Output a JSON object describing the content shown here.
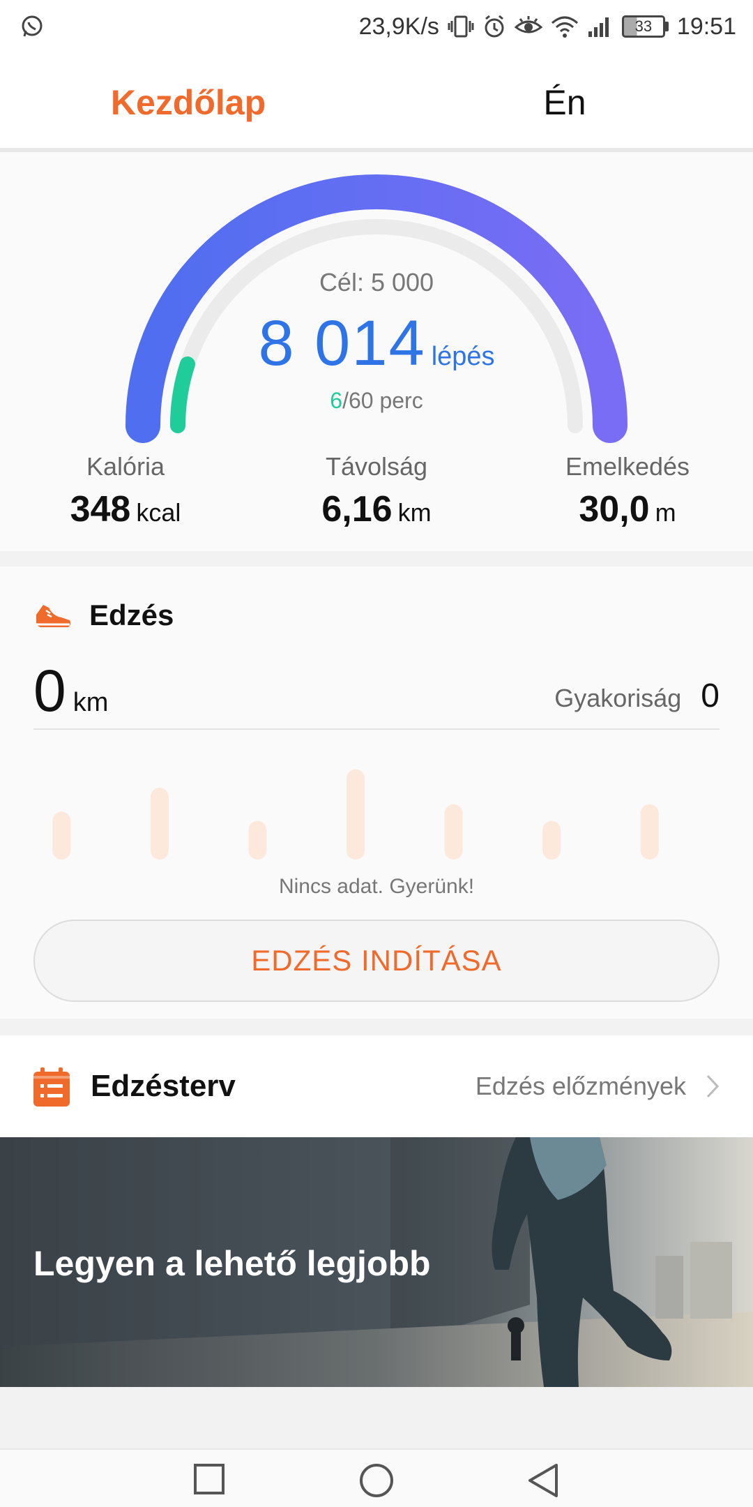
{
  "status_bar": {
    "left_icon": "whatsapp-icon",
    "network_speed": "23,9K/s",
    "icons": [
      "vibrate-icon",
      "alarm-icon",
      "eye-icon",
      "wifi-icon",
      "signal-icon"
    ],
    "battery_level": "33",
    "time": "19:51"
  },
  "tabs": [
    {
      "label": "Kezdőlap",
      "active": true
    },
    {
      "label": "Én",
      "active": false
    }
  ],
  "steps": {
    "goal_text": "Cél: 5 000",
    "count": "8 014",
    "unit": "lépés",
    "active_minutes": "6",
    "active_minutes_total": "/60 perc",
    "goal_progress": 1.0,
    "minutes_progress": 0.1
  },
  "metrics": [
    {
      "label": "Kalória",
      "value": "348",
      "unit": "kcal"
    },
    {
      "label": "Távolság",
      "value": "6,16",
      "unit": "km"
    },
    {
      "label": "Emelkedés",
      "value": "30,0",
      "unit": "m"
    }
  ],
  "workout": {
    "title": "Edzés",
    "icon": "running-shoe-icon",
    "distance": "0",
    "distance_unit": "km",
    "frequency_label": "Gyakoriság",
    "frequency_value": "0",
    "placeholder_bars": [
      0.52,
      0.78,
      0.42,
      0.98,
      0.6,
      0.42,
      0.6
    ],
    "no_data_text": "Nincs adat. Gyerünk!",
    "start_button": "EDZÉS INDÍTÁSA"
  },
  "plan": {
    "icon": "plan-list-icon",
    "title": "Edzésterv",
    "history_link": "Edzés előzmények"
  },
  "banner": {
    "caption": "Legyen a lehető legjobb"
  },
  "colors": {
    "accent": "#f06a2c",
    "steps_blue": "#2f74e6",
    "gauge_start": "#4f6ef0",
    "gauge_end": "#7a6df5",
    "active_green": "#1fcc9a",
    "bar_placeholder": "#fde9dc"
  },
  "nav_bar": [
    "recent-apps-icon",
    "home-icon",
    "back-icon"
  ]
}
